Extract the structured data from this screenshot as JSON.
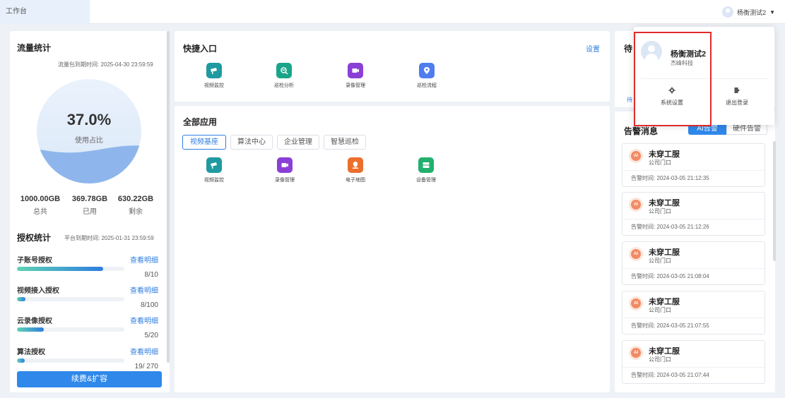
{
  "topbar": {
    "tab_label": "工作台",
    "user_name": "杨衡测试2"
  },
  "traffic": {
    "title": "流量统计",
    "expiry_label": "流量包到期时间: 2025-04-30 23:59:59",
    "percent_text": "37.0%",
    "usage_ratio": 0.37,
    "percent_label": "使用占比",
    "stats": [
      {
        "value": "1000.00GB",
        "label": "总共"
      },
      {
        "value": "369.78GB",
        "label": "已用"
      },
      {
        "value": "630.22GB",
        "label": "剩余"
      }
    ]
  },
  "authorization": {
    "title": "授权统计",
    "expiry_label": "平台到期时间: 2025-01-31 23:59:59",
    "link_label": "查看明细",
    "rows": [
      {
        "name": "子账号授权",
        "count": "8/10",
        "ratio": 0.8
      },
      {
        "name": "视频接入授权",
        "count": "8/100",
        "ratio": 0.08
      },
      {
        "name": "云录像授权",
        "count": "5/20",
        "ratio": 0.25
      },
      {
        "name": "算法授权",
        "count": "19/ 270",
        "ratio": 0.07
      }
    ],
    "renew_button": "续费&扩容"
  },
  "quick_entry": {
    "title": "快捷入口",
    "settings_label": "设置",
    "items": [
      {
        "label": "视频监控",
        "icon": "camera-icon",
        "color": "#1f9aa0"
      },
      {
        "label": "巡检分析",
        "icon": "inspection-analysis-icon",
        "color": "#1aa58a"
      },
      {
        "label": "录像管理",
        "icon": "video-record-icon",
        "color": "#8a3fd6"
      },
      {
        "label": "巡检流程",
        "icon": "location-pin-icon",
        "color": "#4f7df0"
      }
    ]
  },
  "all_apps": {
    "title": "全部应用",
    "categories": [
      "视频基座",
      "算法中心",
      "企业管理",
      "智慧巡检"
    ],
    "active_category": "视频基座",
    "items": [
      {
        "label": "视频监控",
        "icon": "camera-icon",
        "color": "#1f9aa0"
      },
      {
        "label": "录像管理",
        "icon": "video-record-icon",
        "color": "#8a3fd6"
      },
      {
        "label": "电子地图",
        "icon": "map-icon",
        "color": "#ec6f2d"
      },
      {
        "label": "设备管理",
        "icon": "device-icon",
        "color": "#23b06e"
      }
    ]
  },
  "todo": {
    "title": "待",
    "link_text": "待"
  },
  "alerts": {
    "title": "告警消息",
    "tabs": [
      "AI告警",
      "硬件告警"
    ],
    "active_tab": "AI告警",
    "time_label": "告警时间: ",
    "items": [
      {
        "badge": "AI",
        "title": "未穿工服",
        "location": "公司门口",
        "time": "告警时间: 2024-03-05 21:12:35"
      },
      {
        "badge": "AI",
        "title": "未穿工服",
        "location": "公司门口",
        "time": "告警时间: 2024-03-05 21:12:26"
      },
      {
        "badge": "AI",
        "title": "未穿工服",
        "location": "公司门口",
        "time": "告警时间: 2024-03-05 21:08:04"
      },
      {
        "badge": "AI",
        "title": "未穿工服",
        "location": "公司门口",
        "time": "告警时间: 2024-03-05 21:07:55"
      },
      {
        "badge": "AI",
        "title": "未穿工服",
        "location": "公司门口",
        "time": "告警时间: 2024-03-05 21:07:44"
      }
    ]
  },
  "user_menu": {
    "name": "杨衡测试2",
    "company": "杰峰科技",
    "actions": [
      {
        "label": "系统设置",
        "icon": "gear-icon"
      },
      {
        "label": "退出登录",
        "icon": "logout-icon"
      }
    ],
    "highlight_color": "#e02b2b"
  }
}
